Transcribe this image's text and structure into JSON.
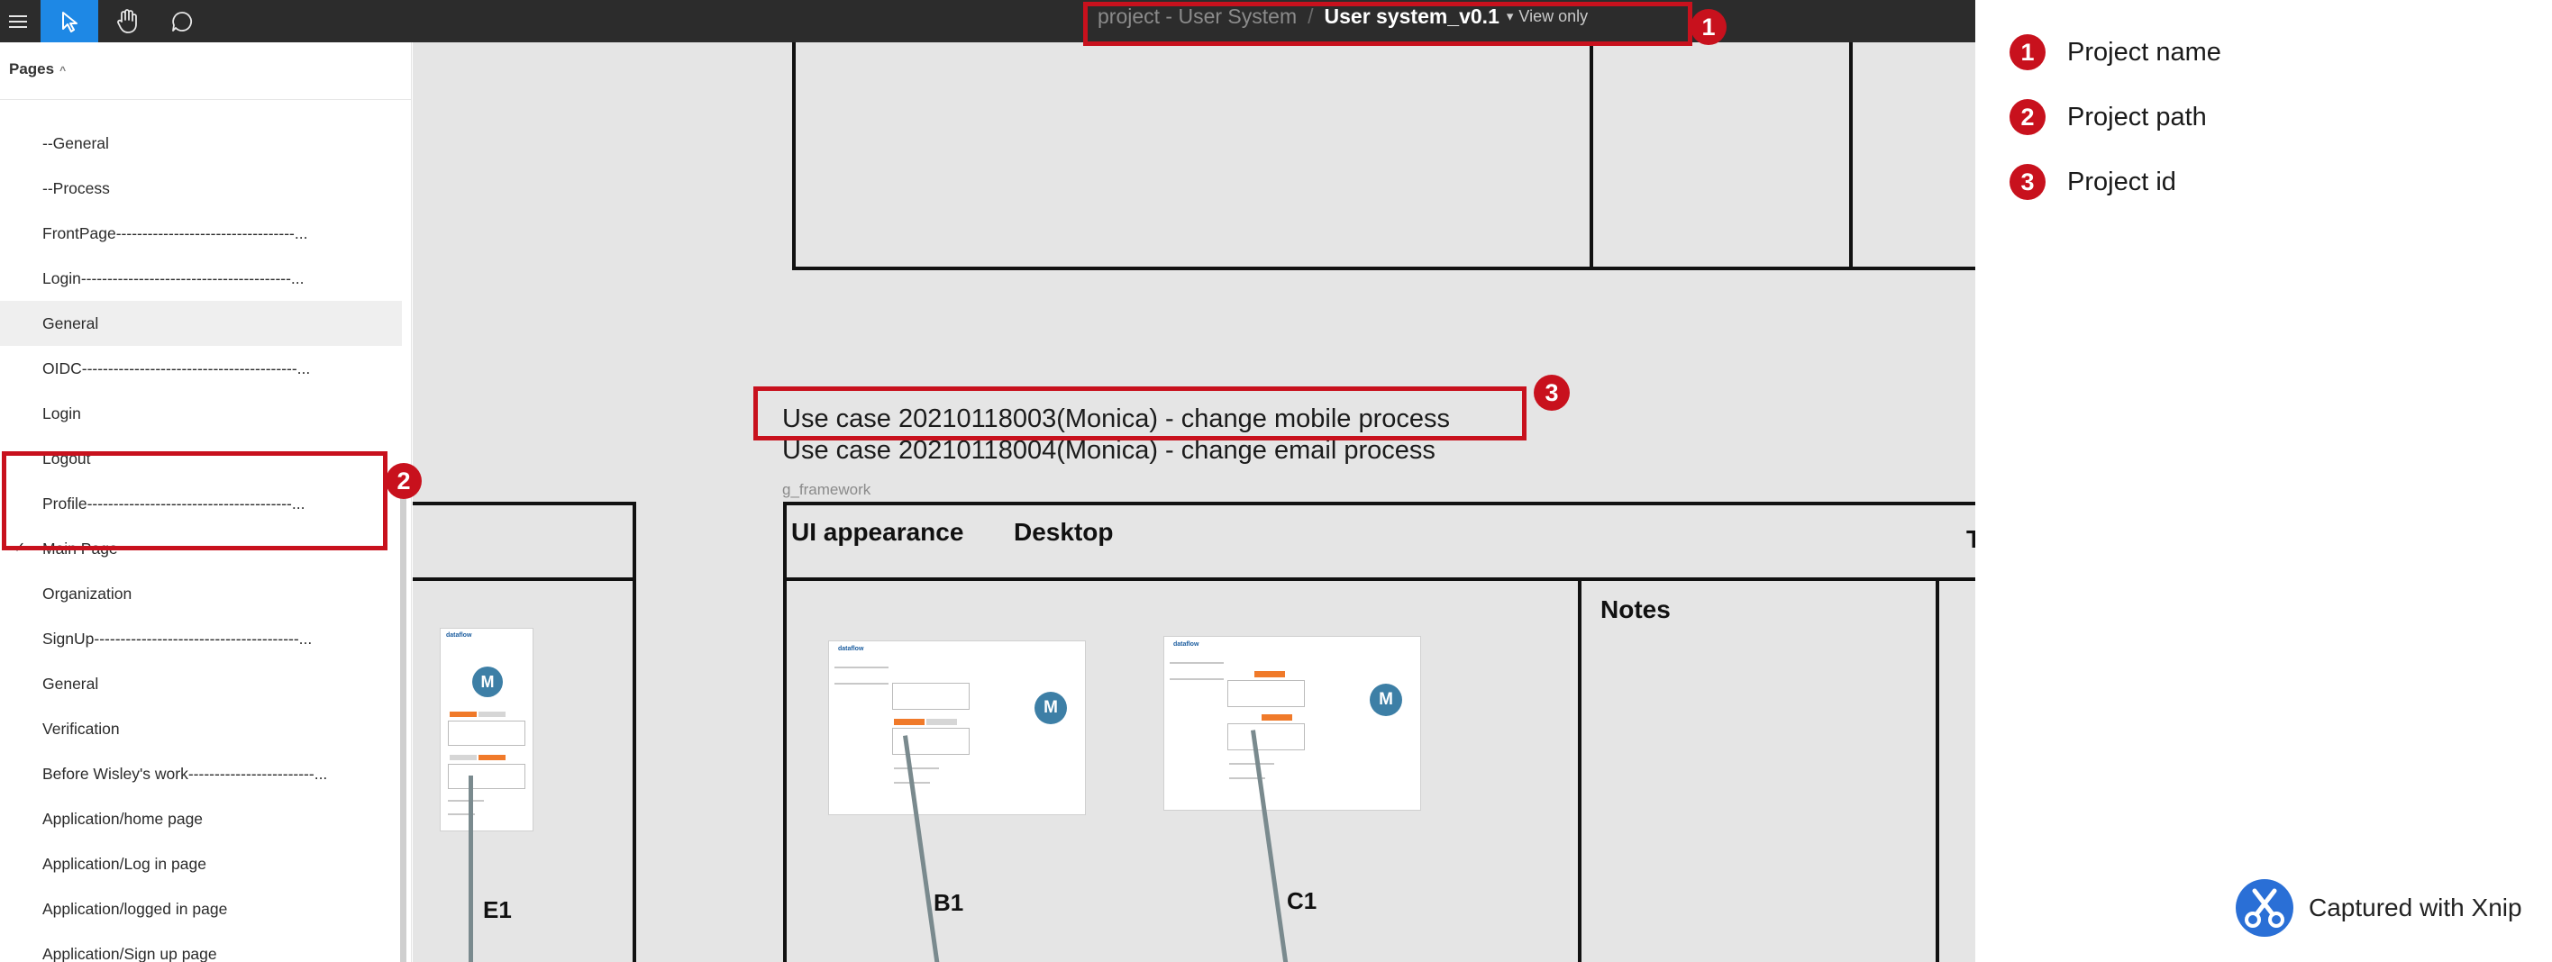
{
  "toolbar": {
    "project": "project - User System",
    "separator": "/",
    "file": "User system_v0.1",
    "view_mode": "View only",
    "active_tool_color": "#1e88e5"
  },
  "sidebar": {
    "header": "Pages",
    "pages": [
      {
        "label": "--General"
      },
      {
        "label": "--Process"
      },
      {
        "label": "FrontPage----------------------------------..."
      },
      {
        "label": "Login----------------------------------------..."
      },
      {
        "label": "General"
      },
      {
        "label": "OIDC-----------------------------------------..."
      },
      {
        "label": "Login"
      },
      {
        "label": "Logout"
      },
      {
        "label": "Profile---------------------------------------..."
      },
      {
        "label": "Main Page"
      },
      {
        "label": "Organization"
      },
      {
        "label": "SignUp---------------------------------------..."
      },
      {
        "label": "General"
      },
      {
        "label": "Verification"
      },
      {
        "label": "Before Wisley's work------------------------..."
      },
      {
        "label": "Application/home page"
      },
      {
        "label": "Application/Log in page"
      },
      {
        "label": "Application/logged in page"
      },
      {
        "label": "Application/Sign up page"
      }
    ]
  },
  "canvas": {
    "use_case_1": "Use case 20210118003(Monica) - change mobile process",
    "use_case_2": "Use case 20210118004(Monica) - change email process",
    "frame_name": "g_framework",
    "ui_appearance": "UI appearance",
    "desktop": "Desktop",
    "notes": "Notes",
    "partial_header": "T",
    "e1": "E1",
    "b1": "B1",
    "c1": "C1",
    "avatar_letter": "M"
  },
  "annotations": {
    "badge_1": "1",
    "badge_2": "2",
    "badge_3": "3",
    "color": "#c8111d"
  },
  "legend": [
    {
      "num": "1",
      "text": "Project name"
    },
    {
      "num": "2",
      "text": "Project path"
    },
    {
      "num": "3",
      "text": "Project id"
    }
  ],
  "watermark": {
    "text": "Captured with Xnip"
  }
}
